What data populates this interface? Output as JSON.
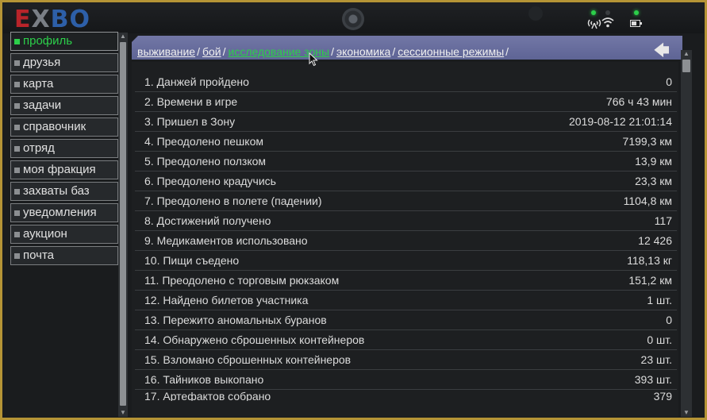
{
  "app": {
    "logo": {
      "e": "E",
      "x": "X",
      "bo": "BO"
    },
    "status_icons": [
      "antenna-icon",
      "wifi-icon",
      "battery-icon"
    ],
    "led_color": "#2ccf4a"
  },
  "sidebar": {
    "items": [
      {
        "label": "профиль",
        "active": true
      },
      {
        "label": "друзья"
      },
      {
        "label": "карта"
      },
      {
        "label": "задачи"
      },
      {
        "label": "справочник"
      },
      {
        "label": "отряд"
      },
      {
        "label": "моя фракция"
      },
      {
        "label": "захваты баз"
      },
      {
        "label": "уведомления"
      },
      {
        "label": "аукцион"
      },
      {
        "label": "почта"
      }
    ]
  },
  "breadcrumbs": {
    "items": [
      "выживание",
      "бой",
      "исследование зоны",
      "экономика",
      "сессионные режимы"
    ],
    "active_index": 2,
    "separator": "/"
  },
  "stats": [
    {
      "label": "1. Данжей пройдено",
      "value": "0"
    },
    {
      "label": "2. Времени в игре",
      "value": "766 ч 43 мин"
    },
    {
      "label": "3. Пришел в Зону",
      "value": "2019-08-12 21:01:14"
    },
    {
      "label": "4. Преодолено пешком",
      "value": "7199,3 км"
    },
    {
      "label": "5. Преодолено ползком",
      "value": "13,9 км"
    },
    {
      "label": "6. Преодолено крадучись",
      "value": "23,3 км"
    },
    {
      "label": "7. Преодолено в полете (падении)",
      "value": "1104,8 км"
    },
    {
      "label": "8. Достижений получено",
      "value": "117"
    },
    {
      "label": "9. Медикаментов использовано",
      "value": "12 426"
    },
    {
      "label": "10. Пищи съедено",
      "value": "118,13 кг"
    },
    {
      "label": "11. Преодолено с торговым рюкзаком",
      "value": "151,2 км"
    },
    {
      "label": "12. Найдено билетов участника",
      "value": "1 шт."
    },
    {
      "label": "13. Пережито аномальных буранов",
      "value": "0"
    },
    {
      "label": "14. Обнаружено сброшенных контейнеров",
      "value": "0 шт."
    },
    {
      "label": "15. Взломано сброшенных контейнеров",
      "value": "23 шт."
    },
    {
      "label": "16. Тайников выкопано",
      "value": "393 шт."
    },
    {
      "label": "17. Артефактов собрано",
      "value": "379"
    }
  ]
}
